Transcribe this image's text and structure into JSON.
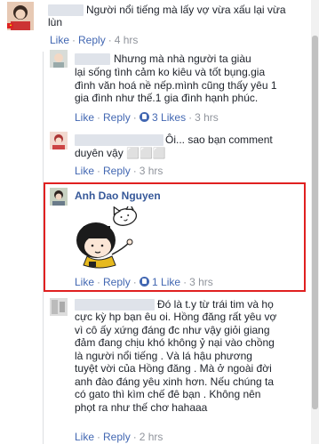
{
  "comments": [
    {
      "text": "Người nổi tiếng mà lấy vợ vừa xấu lại vừa lùn",
      "line1": "Người nổi tiếng mà lấy vợ vừa xấu lại vừa",
      "line2": "lùn",
      "like": "Like",
      "reply": "Reply",
      "time": "4 hrs"
    },
    {
      "line1": "Nhưng mà nhà người ta giàu",
      "line2": "lại sống tình cảm ko kiêu và tốt bụng.gia",
      "line3": "đình văn hoá nề nếp.mình cũng thấy yêu 1",
      "line4": "gia đình như thế.1 gia đình hạnh phúc.",
      "like": "Like",
      "reply": "Reply",
      "likes": "3 Likes",
      "time": "3 hrs"
    },
    {
      "line1": "Ôi... sao bạn comment",
      "line2": "duyên vậy ⬜⬜⬜",
      "like": "Like",
      "reply": "Reply",
      "time": "3 hrs"
    },
    {
      "name": "Anh Dao Nguyen",
      "like": "Like",
      "reply": "Reply",
      "likes": "1 Like",
      "time": "3 hrs"
    },
    {
      "line1": "Đó là t.y từ trái tim và họ",
      "line2": "cực kỳ hp bạn êu oi. Hồng đăng rất yêu vợ",
      "line3": "vì cô ấy xứng đáng đc như vậy giỏi giang",
      "line4": "đảm đang chịu khó không ỷ nại vào chồng",
      "line5": "là người nổi tiếng . Và lá hậu phương",
      "line6": "tuyệt vời của Hồng đăng . Mà ở ngoài đời",
      "line7": "anh đào đáng yêu xinh hơn. Nếu chúng ta",
      "line8": "có gato thì kìm chế đê bạn . Không nên",
      "line9": "phọt ra như thế chơ hahaaa",
      "like": "Like",
      "reply": "Reply",
      "time": "2 hrs"
    }
  ],
  "colors": {
    "link": "#4267b2",
    "muted": "#90949c",
    "highlight": "#e02020"
  },
  "icons": [
    "like-icon",
    "reply-icon",
    "sticker-girl-cat"
  ]
}
